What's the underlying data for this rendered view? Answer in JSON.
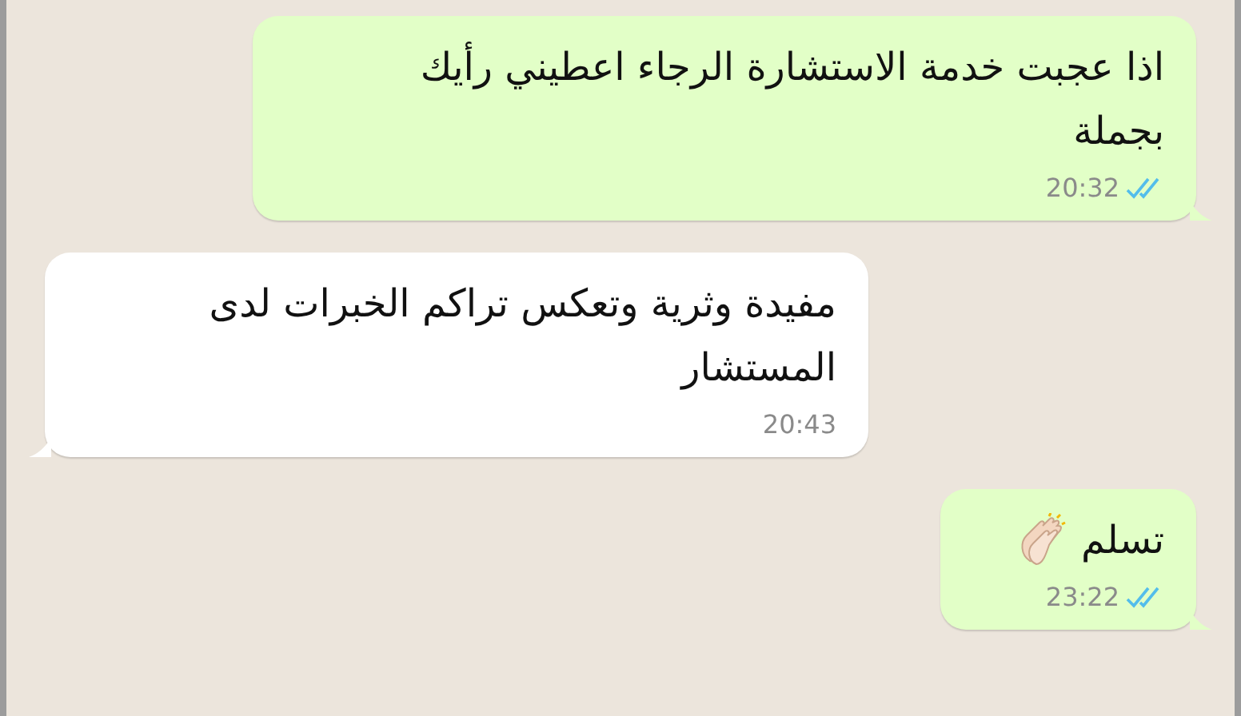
{
  "messages": [
    {
      "kind": "outgoing",
      "text": "اذا عجبت خدمة الاستشارة  الرجاء اعطيني رأيك بجملة",
      "time": "20:32",
      "read": true,
      "clap": false
    },
    {
      "kind": "incoming",
      "text": "مفيدة وثرية وتعكس تراكم الخبرات لدى المستشار",
      "time": "20:43"
    },
    {
      "kind": "outgoing",
      "text": "تسلم",
      "time": "23:22",
      "read": true,
      "clap": true
    }
  ]
}
